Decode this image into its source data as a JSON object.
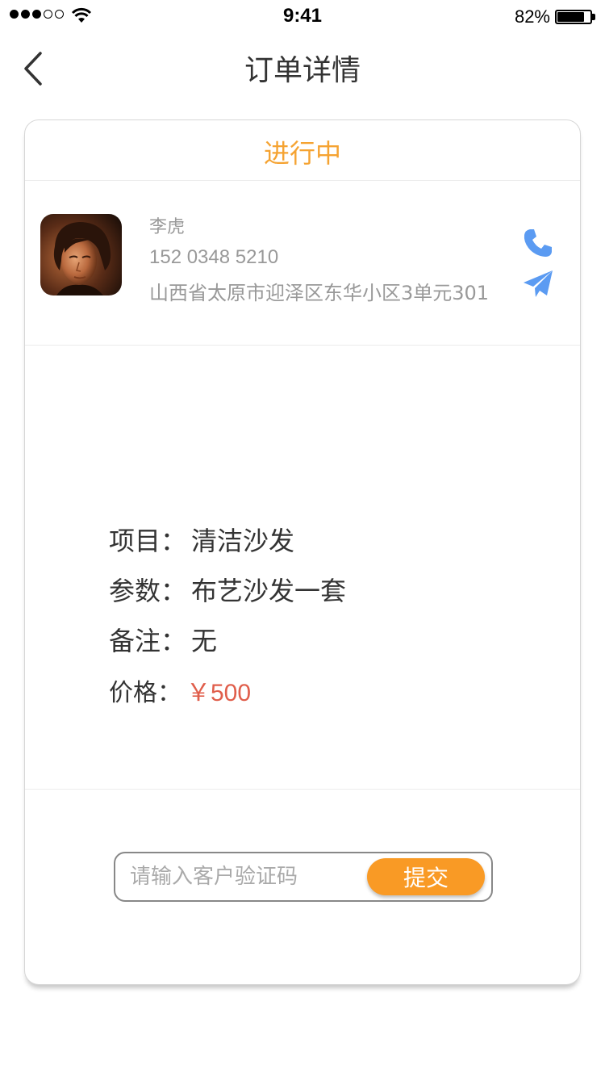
{
  "status_bar": {
    "time": "9:41",
    "battery_percent": "82%",
    "battery_level": 0.82,
    "signal_bars_filled": 3,
    "signal_bars_total": 5
  },
  "nav": {
    "title": "订单详情",
    "back_icon": "chevron-left-icon"
  },
  "order": {
    "status": "进行中",
    "customer": {
      "name": "李虎",
      "phone": "152 0348 5210",
      "address": "山西省太原市迎泽区东华小区3单元301"
    },
    "details": [
      {
        "key": "项目：",
        "value": "清洁沙发"
      },
      {
        "key": "参数：",
        "value": "布艺沙发一套"
      },
      {
        "key": "备注：",
        "value": "无"
      }
    ],
    "price": {
      "key": "价格：",
      "value": "￥500"
    }
  },
  "verify": {
    "placeholder": "请输入客户验证码",
    "submit_label": "提交"
  },
  "colors": {
    "accent_orange": "#f5a332",
    "button_orange": "#f99a25",
    "icon_blue": "#5b9bf2",
    "price_red": "#e05e4b"
  }
}
